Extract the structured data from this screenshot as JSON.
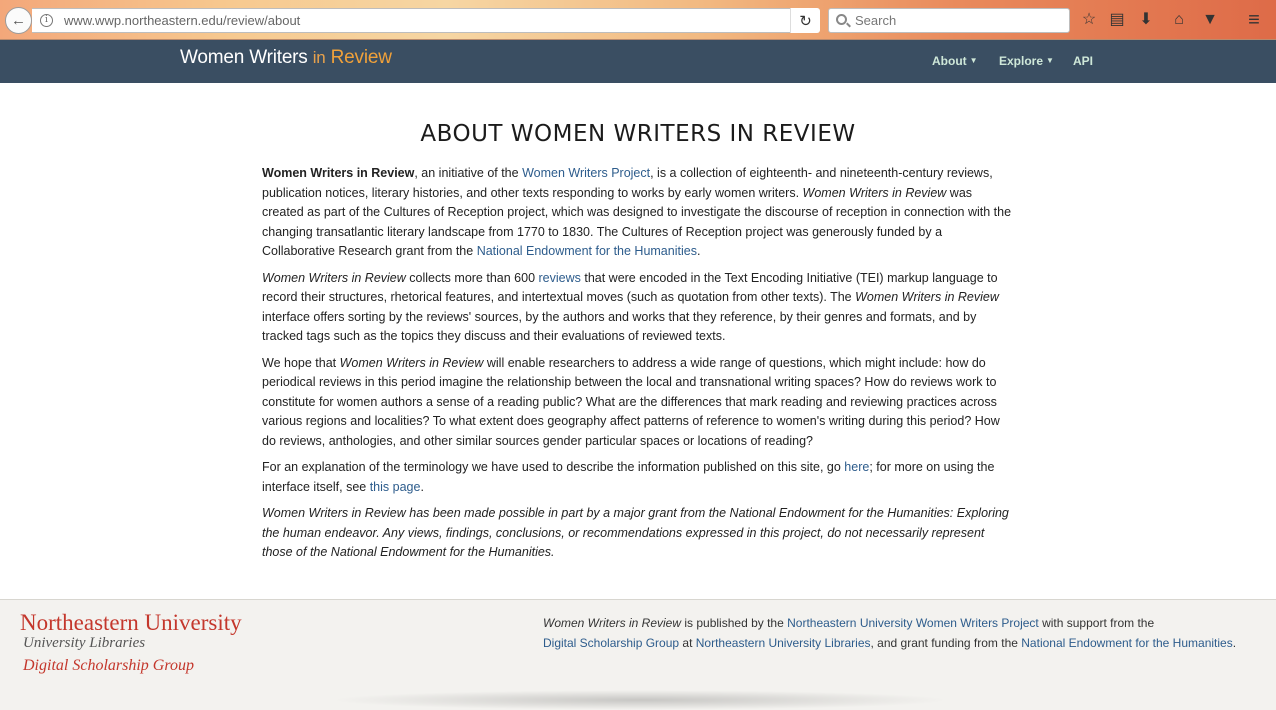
{
  "browser": {
    "url": "www.wwp.northeastern.edu/review/about",
    "search_placeholder": "Search"
  },
  "nav": {
    "brand_main": "Women Writers",
    "brand_in": "in",
    "brand_review": "Review",
    "items": [
      {
        "label": "About"
      },
      {
        "label": "Explore"
      },
      {
        "label": "API"
      }
    ]
  },
  "main": {
    "title": "ABOUT WOMEN WRITERS IN REVIEW",
    "p1": {
      "b1": "Women Writers in Review",
      "t1": ", an initiative of the ",
      "link1": "Women Writers Project",
      "t2": ", is a collection of eighteenth- and nineteenth-century reviews, publication notices, literary histories, and other texts responding to works by early women writers. ",
      "i1": "Women Writers in Review",
      "t3": " was created as part of the Cultures of Reception project, which was designed to investigate the discourse of reception in connection with the changing transatlantic literary landscape from 1770 to 1830. The Cultures of Reception project was generously funded by a Collaborative Research grant from the ",
      "link2": "National Endowment for the Humanities",
      "t4": "."
    },
    "p2": {
      "i1": "Women Writers in Review",
      "t1": " collects more than 600 ",
      "link1": "reviews",
      "t2": " that were encoded in the Text Encoding Initiative (TEI) markup language to record their structures, rhetorical features, and intertextual moves (such as quotation from other texts). The ",
      "i2": "Women Writers in Review",
      "t3": " interface offers sorting by the reviews' sources, by the authors and works that they reference, by their genres and formats, and by tracked tags such as the topics they discuss and their evaluations of reviewed texts."
    },
    "p3": {
      "t1": "We hope that ",
      "i1": "Women Writers in Review",
      "t2": " will enable researchers to address a wide range of questions, which might include: how do periodical reviews in this period imagine the relationship between the local and transnational writing spaces? How do reviews work to constitute for women authors a sense of a reading public? What are the differences that mark reading and reviewing practices across various regions and localities? To what extent does geography affect patterns of reference to women's writing during this period? How do reviews, anthologies, and other similar sources gender particular spaces or locations of reading?"
    },
    "p4": {
      "t1": "For an explanation of the terminology we have used to describe the information published on this site, go ",
      "link1": "here",
      "t2": "; for more on using the interface itself, see ",
      "link2": "this page",
      "t3": "."
    },
    "p5": "Women Writers in Review has been made possible in part by a major grant from the National Endowment for the Humanities: Exploring the human endeavor. Any views, findings, conclusions, or recommendations expressed in this project, do not necessarily represent those of the National Endowment for the Humanities."
  },
  "footer": {
    "nu_name": "Northeastern University",
    "nu_libs": "University Libraries",
    "nu_dsg": "Digital Scholarship Group",
    "i1": "Women Writers in Review",
    "t1": " is published by the ",
    "link1": "Northeastern University Women Writers Project",
    "t2": " with support from the ",
    "link2": "Digital Scholarship Group",
    "t3": " at ",
    "link3": "Northeastern University Libraries",
    "t4": ", and grant funding from the ",
    "link4": "National Endowment for the Humanities",
    "t5": "."
  },
  "colors": {
    "nav_bg": "#3a4e62",
    "brand_accent": "#f0a13a",
    "link": "#2d5c8c",
    "nu_red": "#c4372c"
  },
  "icons": [
    "back-arrow-icon",
    "info-icon",
    "reload-icon",
    "search-icon",
    "bookmark-star-icon",
    "reading-list-icon",
    "download-icon",
    "home-icon",
    "pocket-icon",
    "menu-icon"
  ]
}
